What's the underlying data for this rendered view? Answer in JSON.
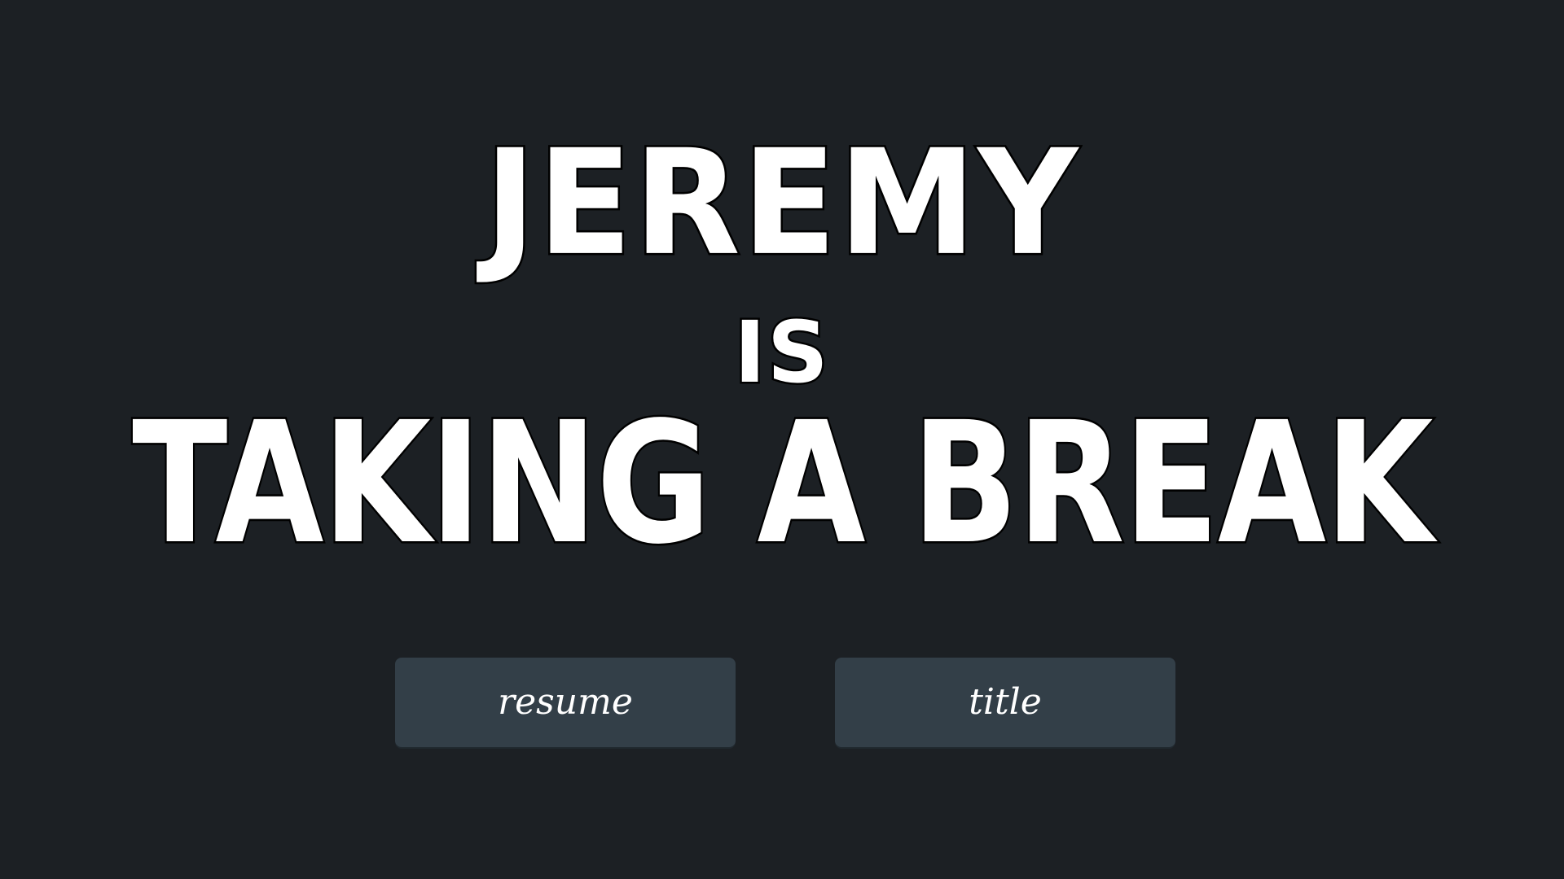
{
  "pause_menu": {
    "heading": {
      "line1": "JEREMY",
      "line2": "IS",
      "line3": "TAKING A BREAK"
    },
    "buttons": {
      "resume_label": "resume",
      "title_label": "title"
    }
  },
  "colors": {
    "background": "#1c2024",
    "button_fill": "#333f48",
    "text": "#ffffff",
    "outline": "#000000"
  }
}
